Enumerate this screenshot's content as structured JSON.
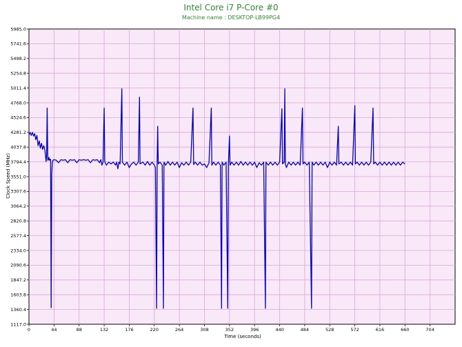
{
  "chart_data": {
    "type": "line",
    "title": "Intel Core i7 P-Core #0",
    "subtitle": "Machine name : DESKTOP-LB99PG4",
    "xlabel": "Time (seconds)",
    "ylabel": "Clock Speed (MHz)",
    "xlim": [
      0,
      748
    ],
    "ylim": [
      1117.0,
      5985.0
    ],
    "x_ticks": [
      "0",
      "44",
      "88",
      "132",
      "176",
      "220",
      "264",
      "308",
      "352",
      "396",
      "440",
      "484",
      "528",
      "572",
      "616",
      "660",
      "704"
    ],
    "y_ticks": [
      "1117.0",
      "1360.4",
      "1603.8",
      "1847.2",
      "2090.6",
      "2334.0",
      "2577.4",
      "2820.8",
      "3064.2",
      "3307.6",
      "3551.0",
      "3794.4",
      "4037.8",
      "4281.2",
      "4524.6",
      "4768.0",
      "5011.4",
      "5254.8",
      "5498.2",
      "5741.6",
      "5985.0"
    ],
    "grid": true,
    "background": "#f8e8f8",
    "grid_color": "#d8a8d8",
    "series": [
      {
        "color": "#0000c0",
        "points": [
          [
            0,
            4240
          ],
          [
            2,
            4280
          ],
          [
            4,
            4230
          ],
          [
            6,
            4280
          ],
          [
            8,
            4220
          ],
          [
            10,
            4260
          ],
          [
            12,
            4160
          ],
          [
            14,
            4230
          ],
          [
            16,
            4060
          ],
          [
            18,
            4140
          ],
          [
            20,
            4020
          ],
          [
            22,
            4100
          ],
          [
            24,
            4000
          ],
          [
            26,
            4060
          ],
          [
            28,
            3990
          ],
          [
            30,
            3800
          ],
          [
            31,
            3900
          ],
          [
            32,
            4680
          ],
          [
            33,
            3820
          ],
          [
            34,
            3830
          ],
          [
            35,
            3870
          ],
          [
            36,
            3820
          ],
          [
            37,
            3840
          ],
          [
            38,
            3830
          ],
          [
            39,
            1390
          ],
          [
            40,
            3580
          ],
          [
            41,
            3780
          ],
          [
            42,
            3820
          ],
          [
            44,
            3830
          ],
          [
            48,
            3820
          ],
          [
            52,
            3780
          ],
          [
            56,
            3830
          ],
          [
            60,
            3820
          ],
          [
            64,
            3830
          ],
          [
            68,
            3780
          ],
          [
            72,
            3830
          ],
          [
            76,
            3820
          ],
          [
            80,
            3830
          ],
          [
            84,
            3780
          ],
          [
            88,
            3830
          ],
          [
            92,
            3820
          ],
          [
            96,
            3830
          ],
          [
            100,
            3820
          ],
          [
            104,
            3830
          ],
          [
            108,
            3780
          ],
          [
            112,
            3830
          ],
          [
            116,
            3820
          ],
          [
            120,
            3830
          ],
          [
            124,
            3780
          ],
          [
            126,
            3830
          ],
          [
            128,
            3740
          ],
          [
            130,
            3790
          ],
          [
            132,
            4680
          ],
          [
            133,
            3800
          ],
          [
            136,
            3740
          ],
          [
            140,
            3790
          ],
          [
            144,
            3760
          ],
          [
            148,
            3790
          ],
          [
            152,
            3740
          ],
          [
            154,
            3790
          ],
          [
            156,
            3680
          ],
          [
            158,
            3790
          ],
          [
            160,
            3760
          ],
          [
            163,
            5000
          ],
          [
            164,
            3790
          ],
          [
            168,
            3740
          ],
          [
            172,
            3790
          ],
          [
            176,
            3700
          ],
          [
            180,
            3760
          ],
          [
            184,
            3790
          ],
          [
            188,
            3740
          ],
          [
            192,
            3790
          ],
          [
            194,
            4860
          ],
          [
            195,
            3760
          ],
          [
            200,
            3790
          ],
          [
            204,
            3740
          ],
          [
            208,
            3800
          ],
          [
            212,
            3740
          ],
          [
            216,
            3790
          ],
          [
            220,
            3740
          ],
          [
            222,
            3700
          ],
          [
            224,
            1380
          ],
          [
            225,
            3800
          ],
          [
            226,
            4380
          ],
          [
            227,
            3760
          ],
          [
            230,
            3790
          ],
          [
            234,
            3740
          ],
          [
            236,
            1380
          ],
          [
            237,
            3790
          ],
          [
            240,
            3740
          ],
          [
            244,
            3800
          ],
          [
            248,
            3740
          ],
          [
            252,
            3790
          ],
          [
            256,
            3740
          ],
          [
            260,
            3790
          ],
          [
            264,
            3700
          ],
          [
            268,
            3780
          ],
          [
            272,
            3740
          ],
          [
            276,
            3790
          ],
          [
            280,
            3740
          ],
          [
            284,
            3790
          ],
          [
            288,
            4680
          ],
          [
            289,
            3750
          ],
          [
            292,
            3790
          ],
          [
            296,
            3740
          ],
          [
            300,
            3790
          ],
          [
            304,
            3740
          ],
          [
            308,
            3760
          ],
          [
            312,
            3700
          ],
          [
            316,
            3780
          ],
          [
            320,
            4680
          ],
          [
            321,
            3740
          ],
          [
            324,
            3790
          ],
          [
            328,
            3740
          ],
          [
            332,
            3790
          ],
          [
            336,
            3740
          ],
          [
            338,
            1380
          ],
          [
            339,
            3790
          ],
          [
            342,
            3740
          ],
          [
            346,
            3790
          ],
          [
            349,
            1380
          ],
          [
            350,
            3750
          ],
          [
            352,
            4220
          ],
          [
            353,
            3740
          ],
          [
            356,
            3790
          ],
          [
            360,
            3740
          ],
          [
            364,
            3790
          ],
          [
            368,
            3740
          ],
          [
            372,
            3800
          ],
          [
            376,
            3740
          ],
          [
            380,
            3790
          ],
          [
            384,
            3740
          ],
          [
            388,
            3790
          ],
          [
            392,
            3740
          ],
          [
            396,
            3790
          ],
          [
            400,
            3700
          ],
          [
            404,
            3780
          ],
          [
            408,
            3740
          ],
          [
            412,
            3790
          ],
          [
            415,
            1380
          ],
          [
            416,
            3790
          ],
          [
            420,
            3740
          ],
          [
            424,
            3790
          ],
          [
            428,
            3740
          ],
          [
            432,
            3790
          ],
          [
            436,
            3740
          ],
          [
            440,
            3790
          ],
          [
            444,
            4670
          ],
          [
            445,
            3760
          ],
          [
            448,
            3790
          ],
          [
            449,
            5000
          ],
          [
            450,
            3760
          ],
          [
            452,
            3700
          ],
          [
            456,
            3790
          ],
          [
            460,
            3740
          ],
          [
            464,
            3790
          ],
          [
            468,
            3740
          ],
          [
            472,
            3790
          ],
          [
            476,
            3740
          ],
          [
            480,
            4680
          ],
          [
            481,
            3760
          ],
          [
            484,
            3790
          ],
          [
            488,
            3740
          ],
          [
            492,
            3790
          ],
          [
            496,
            1380
          ],
          [
            497,
            3790
          ],
          [
            500,
            3740
          ],
          [
            504,
            3790
          ],
          [
            508,
            3740
          ],
          [
            512,
            3790
          ],
          [
            516,
            3740
          ],
          [
            520,
            3790
          ],
          [
            524,
            3700
          ],
          [
            528,
            3790
          ],
          [
            532,
            3740
          ],
          [
            536,
            3790
          ],
          [
            540,
            3740
          ],
          [
            543,
            4380
          ],
          [
            544,
            3760
          ],
          [
            548,
            3790
          ],
          [
            552,
            3740
          ],
          [
            556,
            3790
          ],
          [
            560,
            3740
          ],
          [
            564,
            3790
          ],
          [
            568,
            3740
          ],
          [
            572,
            4720
          ],
          [
            573,
            3760
          ],
          [
            576,
            3790
          ],
          [
            580,
            3740
          ],
          [
            584,
            3790
          ],
          [
            588,
            3740
          ],
          [
            592,
            3790
          ],
          [
            596,
            3740
          ],
          [
            600,
            3790
          ],
          [
            604,
            4680
          ],
          [
            605,
            3760
          ],
          [
            608,
            3790
          ],
          [
            612,
            3740
          ],
          [
            616,
            3790
          ],
          [
            620,
            3740
          ],
          [
            624,
            3790
          ],
          [
            628,
            3740
          ],
          [
            632,
            3790
          ],
          [
            636,
            3740
          ],
          [
            640,
            3790
          ],
          [
            644,
            3740
          ],
          [
            648,
            3790
          ],
          [
            652,
            3740
          ],
          [
            656,
            3790
          ],
          [
            660,
            3760
          ]
        ]
      }
    ]
  }
}
